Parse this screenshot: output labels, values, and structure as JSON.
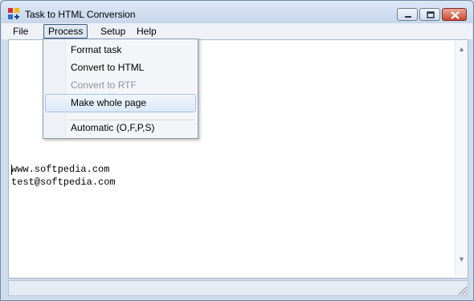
{
  "window": {
    "title": "Task to HTML Conversion"
  },
  "menubar": {
    "items": [
      {
        "label": "File"
      },
      {
        "label": "Process"
      },
      {
        "label": "Setup"
      },
      {
        "label": "Help"
      }
    ]
  },
  "process_menu": {
    "items": [
      {
        "label": "Format task",
        "enabled": true
      },
      {
        "label": "Convert to HTML",
        "enabled": true
      },
      {
        "label": "Convert to RTF",
        "enabled": false
      },
      {
        "label": "Make whole page",
        "enabled": true,
        "highlighted": true
      },
      {
        "label": "Automatic (O,F,P,S)",
        "enabled": true
      }
    ]
  },
  "editor": {
    "lines": [
      "www.softpedia.com",
      "test@softpedia.com"
    ]
  },
  "colors": {
    "accent": "#3b5b84",
    "close_button": "#c9462e",
    "highlight": "#dbe8f8"
  },
  "icons": [
    "app-icon",
    "minimize-icon",
    "maximize-icon",
    "close-icon",
    "scroll-up-icon",
    "scroll-down-icon",
    "resize-grip-icon"
  ]
}
